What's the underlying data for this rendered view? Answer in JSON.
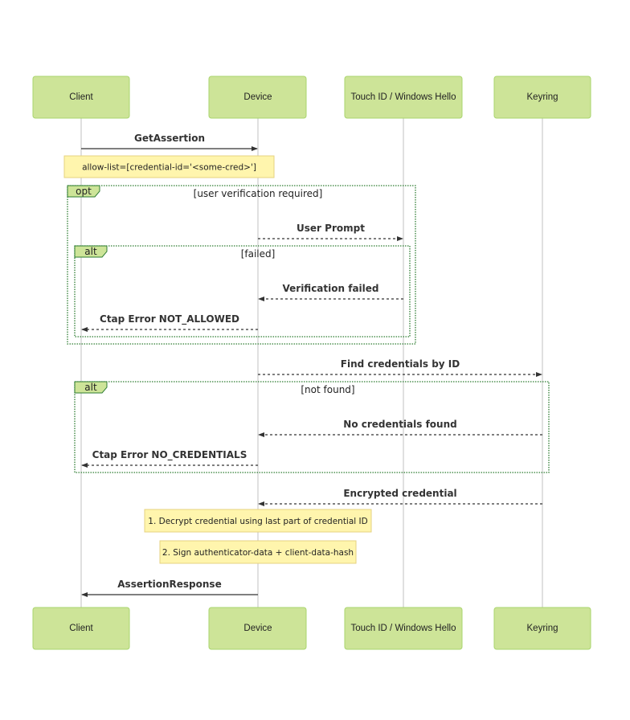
{
  "actors": [
    {
      "id": "client",
      "label": "Client"
    },
    {
      "id": "device",
      "label": "Device"
    },
    {
      "id": "touch",
      "label": "Touch ID / Windows Hello"
    },
    {
      "id": "keyring",
      "label": "Keyring"
    }
  ],
  "messages": [
    {
      "from": "client",
      "to": "device",
      "label": "GetAssertion",
      "style": "solid"
    },
    {
      "from": "device",
      "to": "touch",
      "label": "User Prompt",
      "style": "dashed"
    },
    {
      "from": "touch",
      "to": "device",
      "label": "Verification failed",
      "style": "dashed"
    },
    {
      "from": "device",
      "to": "client",
      "label": "Ctap Error NOT_ALLOWED",
      "style": "dashed"
    },
    {
      "from": "device",
      "to": "keyring",
      "label": "Find credentials by ID",
      "style": "dashed"
    },
    {
      "from": "keyring",
      "to": "device",
      "label": "No credentials found",
      "style": "dashed"
    },
    {
      "from": "device",
      "to": "client",
      "label": "Ctap Error NO_CREDENTIALS",
      "style": "dashed"
    },
    {
      "from": "keyring",
      "to": "device",
      "label": "Encrypted credential",
      "style": "dashed"
    },
    {
      "from": "device",
      "to": "client",
      "label": "AssertionResponse",
      "style": "solid"
    }
  ],
  "notes": [
    {
      "text": "allow-list=[credential-id='<some-cred>']"
    },
    {
      "text": "1. Decrypt credential using last part of credential ID"
    },
    {
      "text": "2. Sign authenticator-data + client-data-hash"
    }
  ],
  "frames": [
    {
      "kind": "opt",
      "condition": "[user verification required]"
    },
    {
      "kind": "alt",
      "condition": "[failed]"
    },
    {
      "kind": "alt",
      "condition": "[not found]"
    }
  ],
  "colors": {
    "actor_fill": "#cde498",
    "actor_border": "#a9d46e",
    "note_fill": "#fff5ad",
    "frame_border": "#2e7d32"
  }
}
